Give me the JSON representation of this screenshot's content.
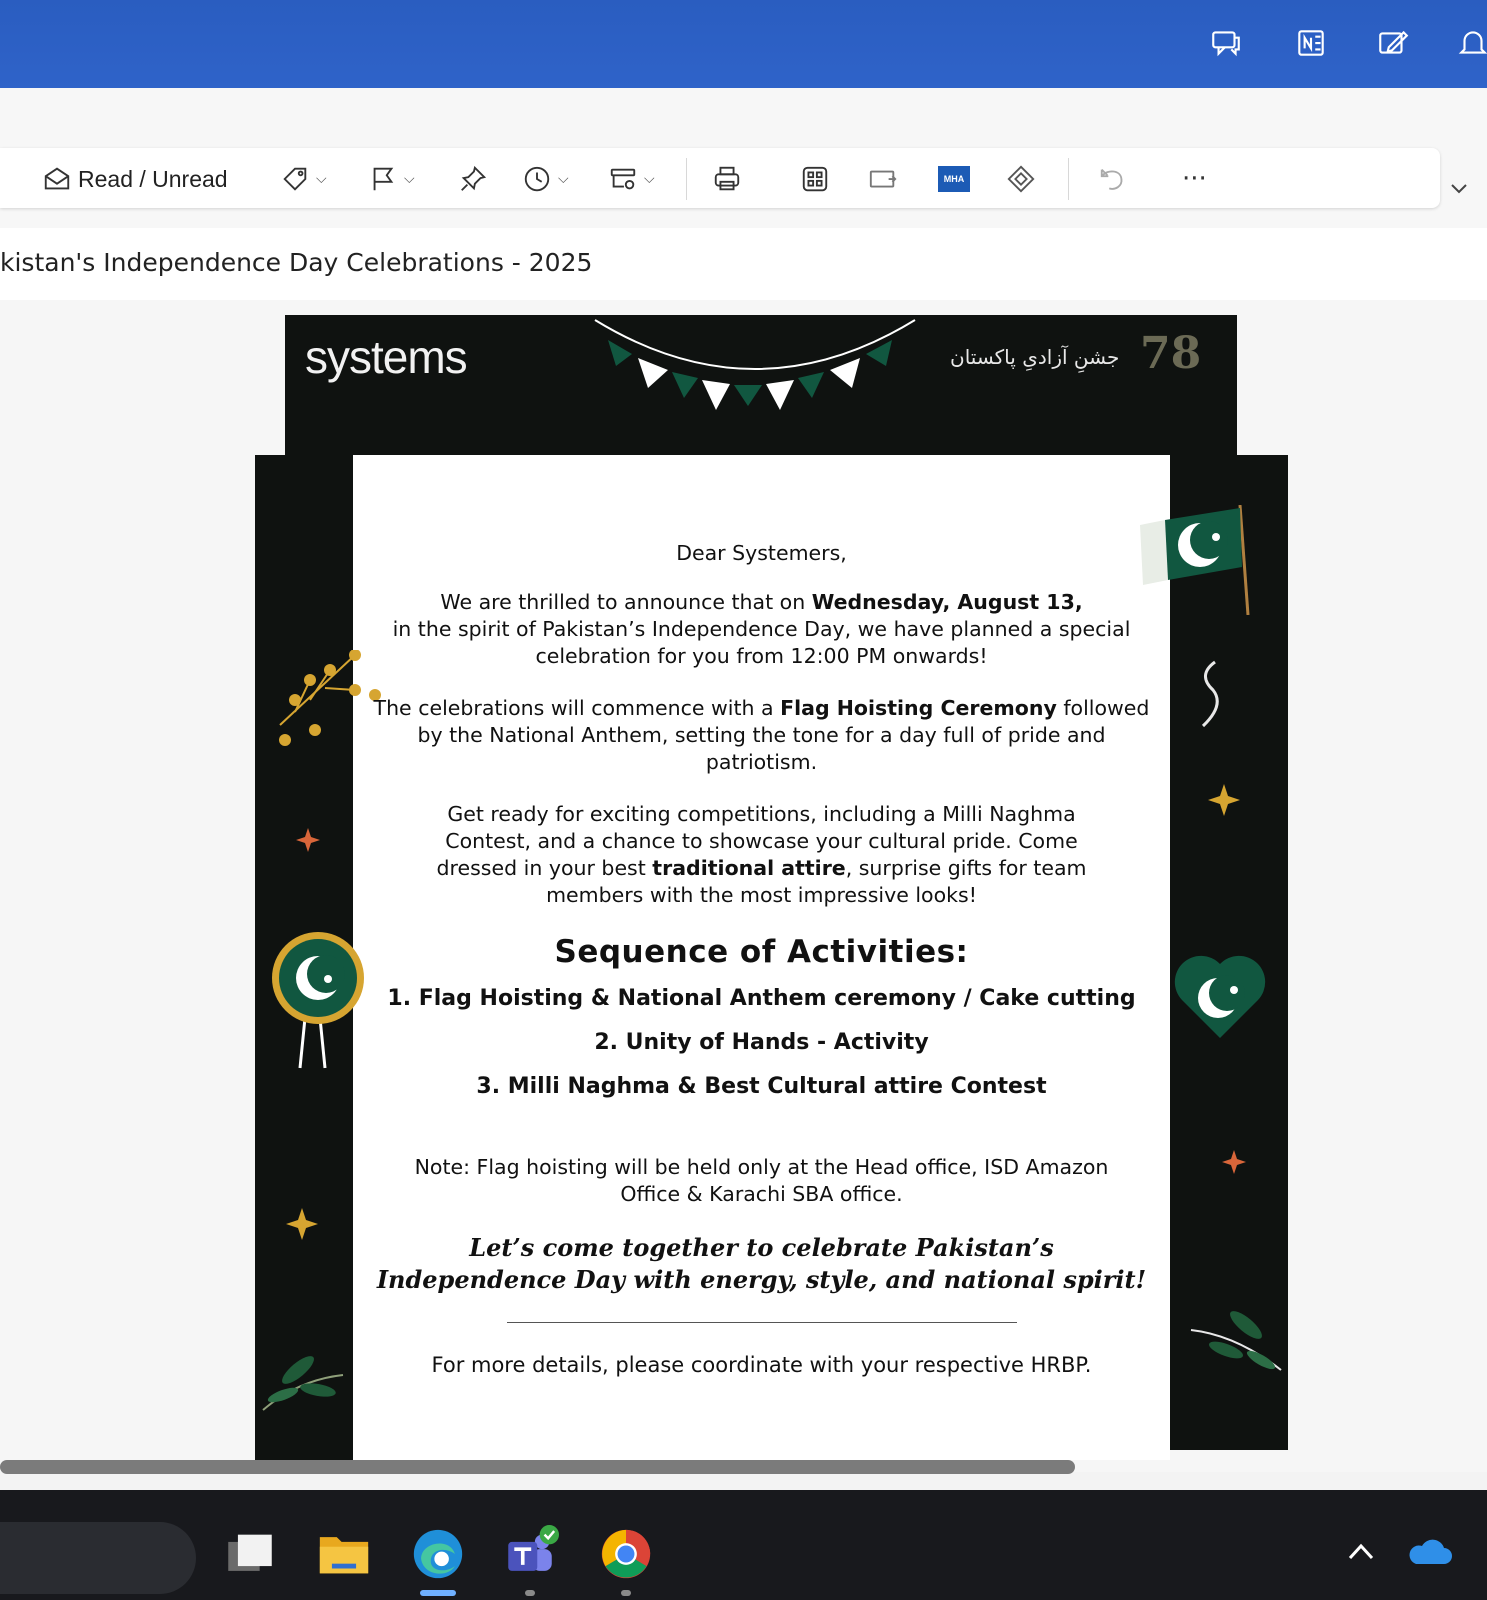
{
  "colors": {
    "titlebar": "#2f63c9",
    "poster_dark": "#0f1210",
    "pak_green": "#115740",
    "gold": "#d6a531"
  },
  "titlebar": {
    "icons": [
      "chat-icon",
      "onenote-icon",
      "edit-note-icon",
      "notification-icon"
    ]
  },
  "toolbar": {
    "read_unread_label": "Read / Unread",
    "mha_label": "MHA",
    "more_label": "···"
  },
  "email": {
    "subject": "kistan's Independence Day Celebrations - 2025"
  },
  "poster": {
    "logo": "systems",
    "urdu_title": "جشنِ آزادیِ پاکستان",
    "badge": "78",
    "greeting": "Dear Systemers,",
    "para1_a": "We are thrilled to announce that on ",
    "para1_bold": "Wednesday, August 13,",
    "para1_b": "in the spirit of Pakistan’s Independence Day, we have planned a special celebration for you from 12:00 PM onwards!",
    "para2_a": "The celebrations will commence with a ",
    "para2_bold": "Flag Hoisting Ceremony",
    "para2_b": " followed by the National Anthem, setting the tone for a day full of pride and patriotism.",
    "para3_a": "Get ready for exciting competitions, including a Milli Naghma Contest, and a chance to showcase your cultural pride. Come dressed in your best ",
    "para3_bold": "traditional attire",
    "para3_b": ", surprise gifts for team members with the most impressive looks!",
    "sequence_title": "Sequence of Activities:",
    "activities": [
      "1. Flag Hoisting & National Anthem ceremony / Cake cutting",
      "2. Unity of Hands - Activity",
      "3. Milli Naghma & Best Cultural attire Contest"
    ],
    "note": "Note: Flag hoisting will be held only at the Head office, ISD Amazon Office & Karachi SBA office.",
    "closing": "Let’s come together to celebrate Pakistan’s Independence Day with energy, style, and national spirit!",
    "more": "For more details, please coordinate with your respective HRBP."
  },
  "taskbar": {
    "apps": [
      "task-view",
      "file-explorer",
      "edge",
      "teams",
      "chrome"
    ]
  }
}
